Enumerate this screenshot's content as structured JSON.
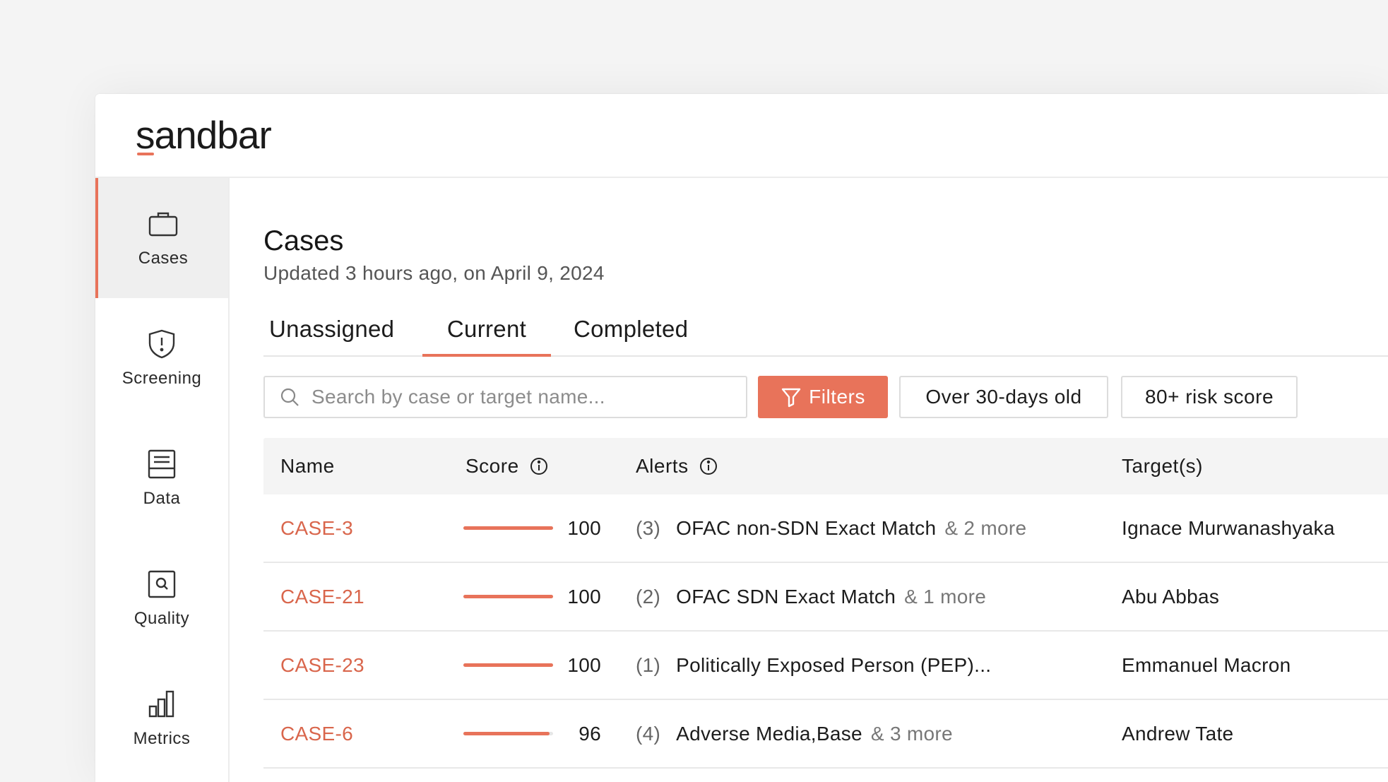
{
  "app": {
    "logo": "sandbar",
    "accent": "#e8735a"
  },
  "sidebar": {
    "items": [
      {
        "label": "Cases",
        "icon": "briefcase-icon",
        "active": true
      },
      {
        "label": "Screening",
        "icon": "shield-icon",
        "active": false
      },
      {
        "label": "Data",
        "icon": "database-icon",
        "active": false
      },
      {
        "label": "Quality",
        "icon": "quality-search-icon",
        "active": false
      },
      {
        "label": "Metrics",
        "icon": "bar-chart-icon",
        "active": false
      }
    ]
  },
  "page": {
    "title": "Cases",
    "subtitle": "Updated 3 hours ago, on April 9, 2024"
  },
  "tabs": [
    {
      "label": "Unassigned",
      "active": false
    },
    {
      "label": "Current",
      "active": true
    },
    {
      "label": "Completed",
      "active": false
    }
  ],
  "toolbar": {
    "search_placeholder": "Search by case or target name...",
    "filters_label": "Filters",
    "chip_1": "Over 30-days old",
    "chip_2": "80+ risk score"
  },
  "table": {
    "headers": {
      "name": "Name",
      "score": "Score",
      "alerts": "Alerts",
      "targets": "Target(s)"
    },
    "rows": [
      {
        "case": "CASE-3",
        "score": 100,
        "score_fraction": 1.0,
        "alert_count": "(3)",
        "alert": "OFAC non-SDN Exact Match",
        "more": "& 2 more",
        "target": "Ignace Murwanashyaka"
      },
      {
        "case": "CASE-21",
        "score": 100,
        "score_fraction": 1.0,
        "alert_count": "(2)",
        "alert": "OFAC SDN Exact Match",
        "more": "& 1 more",
        "target": "Abu Abbas"
      },
      {
        "case": "CASE-23",
        "score": 100,
        "score_fraction": 1.0,
        "alert_count": "(1)",
        "alert": "Politically Exposed Person (PEP)...",
        "more": "",
        "target": "Emmanuel Macron"
      },
      {
        "case": "CASE-6",
        "score": 96,
        "score_fraction": 0.96,
        "alert_count": "(4)",
        "alert": "Adverse Media,Base",
        "more": "& 3 more",
        "target": "Andrew Tate"
      }
    ]
  }
}
